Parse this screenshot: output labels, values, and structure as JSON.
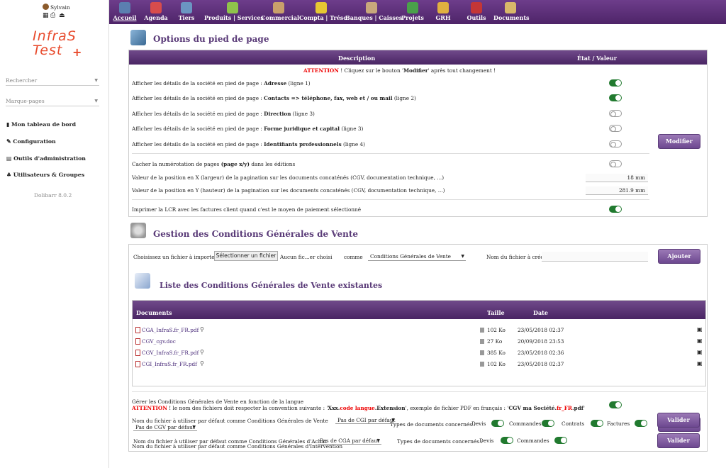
{
  "user": {
    "name": "Sylvain"
  },
  "logo": {
    "line1": "InfraS",
    "line2": "Test",
    "plus": "+"
  },
  "left_menu": {
    "search_label": "Rechercher",
    "bookmarks_label": "Marque-pages",
    "items": [
      {
        "label": "Mon tableau de bord"
      },
      {
        "label": "Configuration"
      },
      {
        "label": "Outils d'administration"
      },
      {
        "label": "Utilisateurs & Groupes"
      }
    ],
    "version": "Dolibarr 8.0.2"
  },
  "topmenu": [
    {
      "label": "Accueil",
      "color": "#5b7fb0"
    },
    {
      "label": "Agenda",
      "color": "#d84c4c"
    },
    {
      "label": "Tiers",
      "color": "#6b95c2"
    },
    {
      "label": "Produits | Services",
      "color": "#8fc24b"
    },
    {
      "label": "Commercial",
      "color": "#c9a06b"
    },
    {
      "label": "Compta | Tréso",
      "color": "#e6c832"
    },
    {
      "label": "Banques | Caisses",
      "color": "#c8a87c"
    },
    {
      "label": "Projets",
      "color": "#4aa04a"
    },
    {
      "label": "GRH",
      "color": "#e0b040"
    },
    {
      "label": "Outils",
      "color": "#c43636"
    },
    {
      "label": "Documents",
      "color": "#d8b86a"
    }
  ],
  "footer_section": {
    "title": "Options du pied de page",
    "col_desc": "Description",
    "col_state": "État / Valeur",
    "attention_prefix": "ATTENTION",
    "attention_text": " ! Cliquez sur le bouton '",
    "attention_bold": "Modifier",
    "attention_end": "' après tout changement !",
    "rows": [
      {
        "pre": "Afficher les détails de la société en pied de page : ",
        "bold": "Adresse",
        "post": " (ligne 1)"
      },
      {
        "pre": "Afficher les détails de la société en pied de page : ",
        "bold": "Contacts => téléphone, fax, web et / ou mail",
        "post": " (ligne 2)"
      },
      {
        "pre": "Afficher les détails de la société en pied de page : ",
        "bold": "Direction",
        "post": " (ligne 3)"
      },
      {
        "pre": "Afficher les détails de la société en pied de page : ",
        "bold": "Forme juridique et capital",
        "post": " (ligne 3)"
      },
      {
        "pre": "Afficher les détails de la société en pied de page : ",
        "bold": "Identifiants professionnels",
        "post": " (ligne 4)"
      }
    ],
    "modify_button": "Modifier",
    "hide_pages_pre": "Cacher la numérotation de pages ",
    "hide_pages_bold": "(page x/y)",
    "hide_pages_post": " dans les éditions",
    "posx_label": "Valeur de la position en X (largeur) de la pagination sur les documents concaténés (CGV, documentation technique, ...)",
    "posx_value": "18 mm",
    "posy_label": "Valeur de la position en Y (hauteur) de la pagination sur les documents concaténés (CGV, documentation technique, ...)",
    "posy_value": "281.9 mm",
    "lcr_label": "Imprimer la LCR avec les factures client quand c'est le moyen de paiement sélectionné"
  },
  "cgv_section": {
    "title": "Gestion des Conditions Générales de Vente",
    "import_label": "Choisissez un fichier à importer",
    "choose_button": "Sélectionner un fichier",
    "no_file": "Aucun fic...er choisi",
    "as_label": "comme",
    "type_select": "Conditions Générales de Vente",
    "filename_label": "Nom du fichier à créer",
    "add_button": "Ajouter",
    "list_title": "Liste des Conditions Générales de Vente existantes",
    "col_docs": "Documents",
    "col_size": "Taille",
    "col_date": "Date",
    "files": [
      {
        "name": "CGA_InfraS.fr_FR.pdf",
        "size": "102 Ko",
        "date": "23/05/2018 02:37",
        "preview": true
      },
      {
        "name": "CGV_cgv.doc",
        "size": "27 Ko",
        "date": "20/09/2018 23:53",
        "preview": false
      },
      {
        "name": "CGV_InfraS.fr_FR.pdf",
        "size": "385 Ko",
        "date": "23/05/2018 02:36",
        "preview": true
      },
      {
        "name": "CGI_InfraS.fr_FR.pdf",
        "size": "102 Ko",
        "date": "23/05/2018 02:37",
        "preview": true
      }
    ],
    "lang_manage": "Gérer les Conditions Générales de Vente en fonction de la langue",
    "lang_attention": "ATTENTION",
    "lang_text1": " ! le nom des fichiers doit respecter la convention suivante : '",
    "lang_xxx": "Xxx.",
    "lang_code": "code langue",
    "lang_ext": ".Extension",
    "lang_text2": "', exemple de fichier PDF en français : '",
    "lang_example1": "CGV ma Société.",
    "lang_example2": "fr_FR",
    "lang_example3": ".pdf",
    "lang_text3": "'",
    "cgv_default_label": "Nom du fichier à utiliser par défaut comme Conditions Générales de Vente",
    "cgv_default_value": "Pas de CGV par défaut",
    "doc_types_label": "Types de documents concernés :",
    "doc_types": [
      "Devis",
      "Commandes",
      "Contrats",
      "Factures"
    ],
    "cgi_default_label": "Nom du fichier à utiliser par défaut comme Conditions Générales d'Intervention",
    "cgi_default_value": "Pas de CGI par défaut",
    "cga_default_label": "Nom du fichier à utiliser par défaut comme Conditions Générales d'Achat",
    "cga_default_value": "Pas de CGA par défaut",
    "cga_doc_types": [
      "Devis",
      "Commandes"
    ],
    "validate_button": "Valider"
  }
}
